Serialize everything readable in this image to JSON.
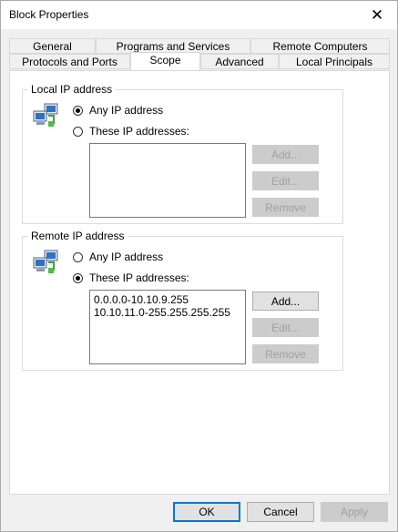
{
  "window": {
    "title": "Block Properties"
  },
  "tabs_row1": [
    "General",
    "Programs and Services",
    "Remote Computers"
  ],
  "tabs_row2": [
    "Protocols and Ports",
    "Scope",
    "Advanced",
    "Local Principals"
  ],
  "local": {
    "group_title": "Local IP address",
    "option_any": "Any IP address",
    "option_these": "These IP addresses:",
    "selected": "any",
    "addresses": [],
    "add": "Add...",
    "edit": "Edit...",
    "remove": "Remove"
  },
  "remote": {
    "group_title": "Remote IP address",
    "option_any": "Any IP address",
    "option_these": "These IP addresses:",
    "selected": "these",
    "addresses": [
      "0.0.0.0-10.10.9.255",
      "10.10.11.0-255.255.255.255"
    ],
    "add": "Add...",
    "edit": "Edit...",
    "remove": "Remove"
  },
  "footer": {
    "ok": "OK",
    "cancel": "Cancel",
    "apply": "Apply"
  },
  "icons": {
    "close": "close-icon",
    "network": "network-computers-icon"
  },
  "colors": {
    "focus_border": "#0078d7",
    "disabled_text": "#a0a0a0"
  }
}
